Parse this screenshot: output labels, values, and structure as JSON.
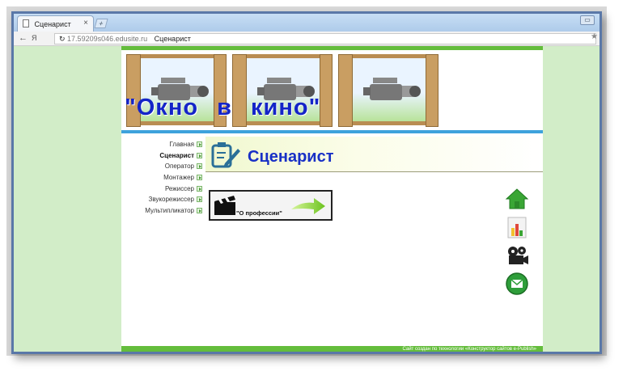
{
  "browser": {
    "tab_title": "Сценарист",
    "tab_close": "×",
    "new_tab": "+",
    "back_icon": "←",
    "reload_icon": "Я",
    "url": "17.59209s046.edusite.ru",
    "address_title": "Сценарист",
    "star": "★"
  },
  "site": {
    "banner_title": "\"Окно в кино\"",
    "nav": [
      {
        "label": "Главная",
        "active": false
      },
      {
        "label": "Сценарист",
        "active": true
      },
      {
        "label": "Оператор",
        "active": false
      },
      {
        "label": "Монтажер",
        "active": false
      },
      {
        "label": "Режиссер",
        "active": false
      },
      {
        "label": "Звукорежиссер",
        "active": false
      },
      {
        "label": "Мультипликатор",
        "active": false
      }
    ],
    "page_title": "Сценарист",
    "profession_button": "\"О профессии\"",
    "right_icons": [
      "home-icon",
      "chart-icon",
      "film-reel-icon",
      "mail-icon"
    ],
    "footer_text": "Сайт создан по технологии «Конструктор сайтов e-Publish»"
  },
  "colors": {
    "green_stripe": "#64bd3c",
    "blue_band": "#3ea2dc",
    "title_blue": "#1424c8",
    "page_bg": "#d2edc8"
  }
}
